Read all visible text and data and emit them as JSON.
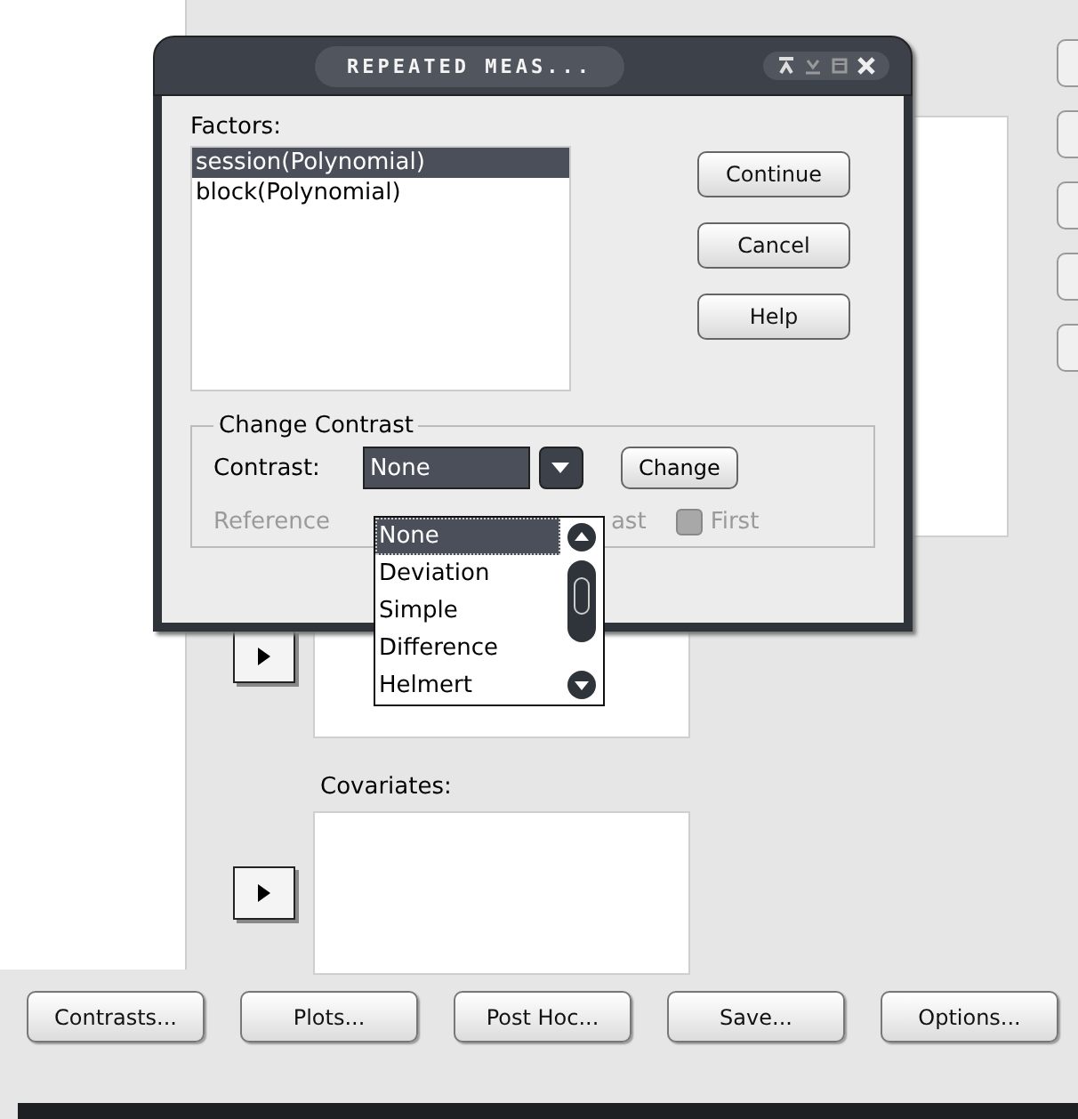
{
  "main_window": {
    "covariates_label": "Covariates:",
    "buttons": [
      "Contrasts...",
      "Plots...",
      "Post Hoc...",
      "Save...",
      "Options..."
    ]
  },
  "dialog": {
    "title": "REPEATED MEAS...",
    "factors_label": "Factors:",
    "factors": [
      {
        "label": "session(Polynomial)",
        "selected": true
      },
      {
        "label": "block(Polynomial)",
        "selected": false
      }
    ],
    "buttons": [
      "Continue",
      "Cancel",
      "Help"
    ],
    "group_title": "Change Contrast",
    "contrast_label": "Contrast:",
    "contrast_value": "None",
    "change_button": "Change",
    "reference": {
      "label": "Reference",
      "last_label": "ast",
      "first_label": "First",
      "first_checked": false,
      "disabled": true
    }
  },
  "dropdown": {
    "items": [
      {
        "label": "None",
        "selected": true
      },
      {
        "label": "Deviation",
        "selected": false
      },
      {
        "label": "Simple",
        "selected": false
      },
      {
        "label": "Difference",
        "selected": false
      },
      {
        "label": "Helmert",
        "selected": false
      }
    ]
  }
}
